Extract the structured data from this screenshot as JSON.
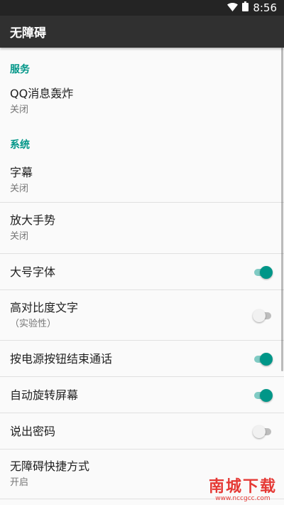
{
  "status_bar": {
    "time": "8:56",
    "wifi_icon": "wifi-icon",
    "battery_icon": "battery-icon"
  },
  "app_bar": {
    "title": "无障碍"
  },
  "sections": [
    {
      "header": "服务",
      "items": [
        {
          "title": "QQ消息轰炸",
          "summary": "关闭"
        }
      ]
    },
    {
      "header": "系统",
      "items": [
        {
          "title": "字幕",
          "summary": "关闭"
        },
        {
          "title": "放大手势",
          "summary": "关闭"
        },
        {
          "title": "大号字体",
          "toggle": true
        },
        {
          "title": "高对比度文字",
          "summary": "（实验性）",
          "toggle": false
        },
        {
          "title": "按电源按钮结束通话",
          "toggle": true
        },
        {
          "title": "自动旋转屏幕",
          "toggle": true
        },
        {
          "title": "说出密码",
          "toggle": false
        },
        {
          "title": "无障碍快捷方式",
          "summary": "开启"
        }
      ]
    }
  ],
  "colors": {
    "accent": "#009688",
    "app_bar": "#303030",
    "status_bar": "#242424"
  },
  "watermark": {
    "main": "南城下载",
    "sub": "www.nccgcc.com"
  }
}
